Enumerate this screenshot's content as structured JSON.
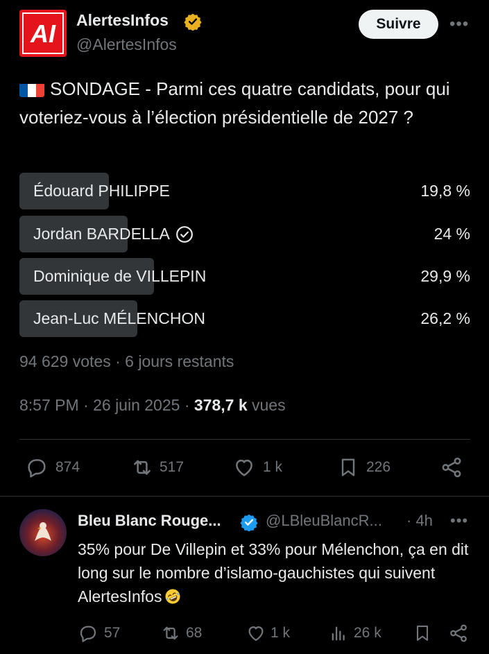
{
  "author": {
    "name": "AlertesInfos",
    "handle": "@AlertesInfos",
    "logo_text": "AI",
    "follow_label": "Suivre"
  },
  "tweet": {
    "text": "SONDAGE - Parmi ces quatre candidats, pour qui voteriez-vous à l’élection présidentielle de 2027 ?",
    "flag": "france-flag"
  },
  "poll": {
    "options": [
      {
        "label": "Édouard PHILIPPE",
        "percent_text": "19,8 %",
        "percent": 19.8
      },
      {
        "label": "Jordan BARDELLA",
        "percent_text": "24 %",
        "percent": 24
      },
      {
        "label": "Dominique de VILLEPIN",
        "percent_text": "29,9 %",
        "percent": 29.9
      },
      {
        "label": "Jean-Luc MÉLENCHON",
        "percent_text": "26,2 %",
        "percent": 26.2
      }
    ],
    "meta": "94 629 votes · 6 jours restants"
  },
  "timestamp": {
    "time_date": "8:57 PM · 26 juin 2025 · ",
    "views_count": "378,7 k",
    "views_label": " vues"
  },
  "actions": {
    "replies": "874",
    "reposts": "517",
    "likes": "1 k",
    "bookmarks": "226"
  },
  "reply": {
    "name": "Bleu Blanc Rouge...",
    "handle": "@LBleuBlancR...",
    "time": "· 4h",
    "text": "35% pour De Villepin et 33% pour Mélenchon, ça en dit long sur le nombre d’islamo-gauchistes qui suivent AlertesInfos",
    "emoji": "rolling-on-floor-laughing",
    "actions": {
      "replies": "57",
      "reposts": "68",
      "likes": "1 k",
      "views": "26 k"
    }
  },
  "colors": {
    "background": "#000000",
    "text": "#e7e9ea",
    "muted": "#71767b",
    "poll_bar": "#333639",
    "brand_red": "#e4141b",
    "verified_gold": "#e9b11f",
    "verified_blue": "#1d9bf0"
  }
}
